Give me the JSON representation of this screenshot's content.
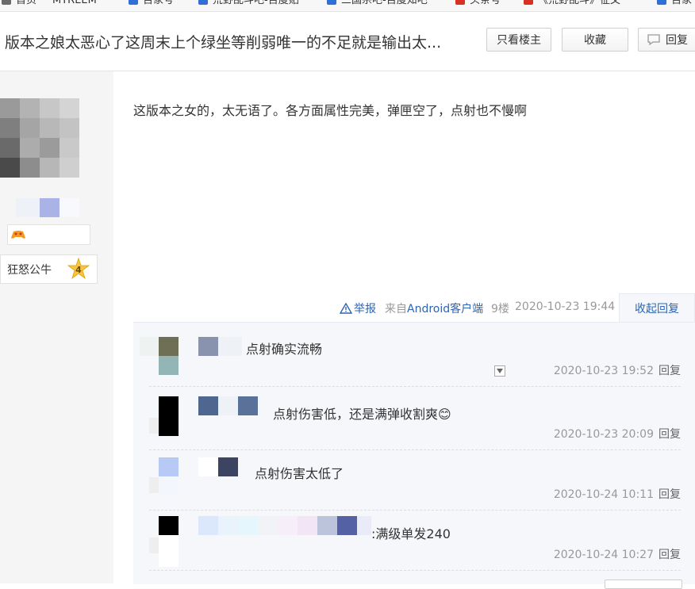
{
  "bookmarks": [
    {
      "label": "首页",
      "color": "#6a6a6a"
    },
    {
      "label": "MYREEM",
      "color": ""
    },
    {
      "label": "百家号",
      "color": "#2f6fd6"
    },
    {
      "label": "荒野乱斗吧-百度贴",
      "color": "#2f6fd6"
    },
    {
      "label": "三国杀吧-百度知吧",
      "color": "#2f6fd6"
    },
    {
      "label": "头条号",
      "color": "#d93025"
    },
    {
      "label": "《荒野乱斗》征文",
      "color": "#d93025"
    },
    {
      "label": "百家",
      "color": "#2f6fd6"
    }
  ],
  "header": {
    "title": "版本之娘太恶心了这周末上个绿坐等削弱唯一的不足就是输出太...",
    "only_op_label": "只看楼主",
    "favorite_label": "收藏",
    "reply_label": "回复"
  },
  "sidebar": {
    "level_name": "狂怒公牛",
    "level_number": "4"
  },
  "post": {
    "content": "这版本之女的，太无语了。各方面属性完美，弹匣空了，点射也不慢啊",
    "report_label": "举报",
    "source_prefix": "来自",
    "source_client": "Android客户端",
    "floor": "9楼",
    "date": "2020-10-23 19:44",
    "collapse_label": "收起回复"
  },
  "replies": [
    {
      "text": "点射确实流畅",
      "date": "2020-10-23 19:52",
      "reply_label": "回复"
    },
    {
      "text": "点射伤害低，还是满弹收割爽",
      "date": "2020-10-23 20:09",
      "reply_label": "回复",
      "emoji": "😊"
    },
    {
      "text": "点射伤害太低了",
      "date": "2020-10-24 10:11",
      "reply_label": "回复"
    },
    {
      "text": ":满级单发240",
      "date": "2020-10-24 10:27",
      "reply_label": "回复"
    }
  ],
  "colors": {
    "link": "#2d64b3",
    "panel": "#f5f7fa",
    "sidebar": "#f5f5f5"
  }
}
